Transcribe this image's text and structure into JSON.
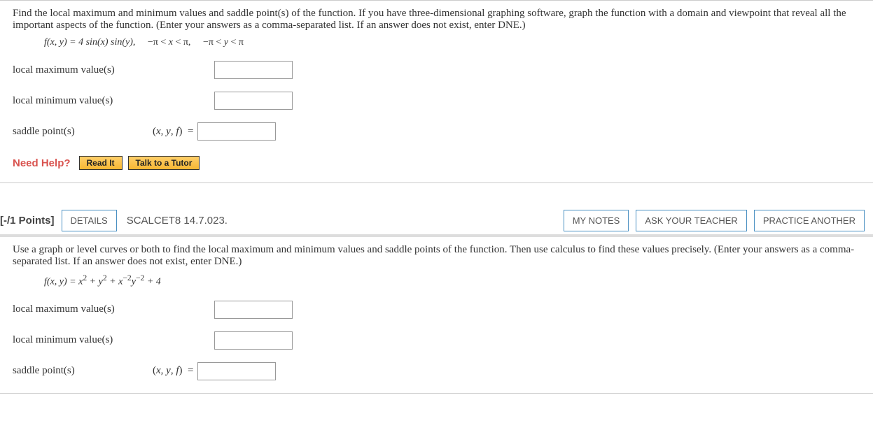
{
  "q1": {
    "prompt": "Find the local maximum and minimum values and saddle point(s) of the function. If you have three-dimensional graphing software, graph the function with a domain and viewpoint that reveal all the important aspects of the function. (Enter your answers as a comma-separated list. If an answer does not exist, enter DNE.)",
    "func_html": "f(x, y) = 4 sin(x) sin(y),    −π < x < π,    −π < y < π",
    "rows": {
      "max_label": "local maximum value(s)",
      "min_label": "local minimum value(s)",
      "saddle_label": "saddle point(s)",
      "saddle_prefix": "(x, y, f)  ="
    },
    "needhelp": "Need Help?",
    "readit": "Read It",
    "tutor": "Talk to a Tutor"
  },
  "q2": {
    "points": "[-/1 Points]",
    "details": "DETAILS",
    "ref": "SCALCET8 14.7.023.",
    "mynotes": "MY NOTES",
    "ask": "ASK YOUR TEACHER",
    "practice": "PRACTICE ANOTHER",
    "prompt": "Use a graph or level curves or both to find the local maximum and minimum values and saddle points of the function. Then use calculus to find these values precisely. (Enter your answers as a comma-separated list. If an answer does not exist, enter DNE.)",
    "func_html": "f(x, y) = x² + y² + x⁻²y⁻² + 4",
    "rows": {
      "max_label": "local maximum value(s)",
      "min_label": "local minimum value(s)",
      "saddle_label": "saddle point(s)",
      "saddle_prefix": "(x, y, f)  ="
    }
  }
}
